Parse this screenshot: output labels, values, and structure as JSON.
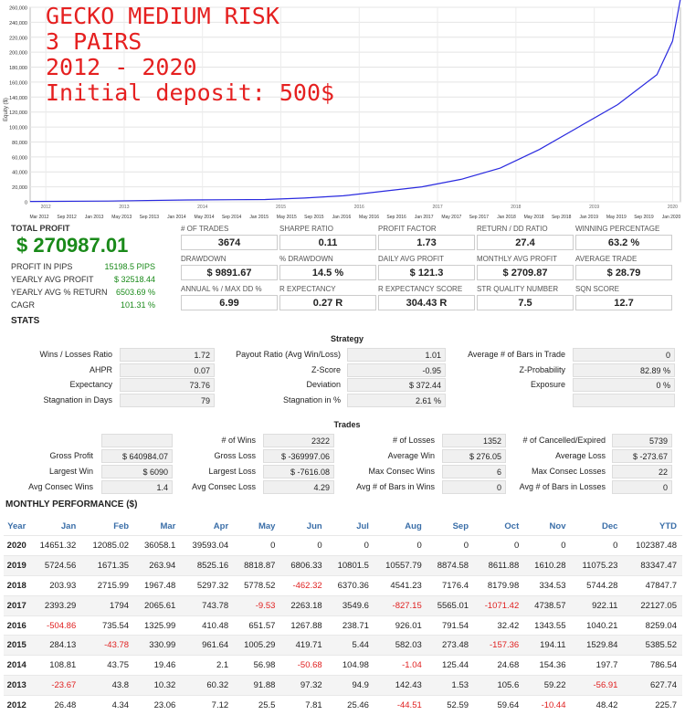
{
  "overlay": {
    "line1": "GECKO MEDIUM RISK",
    "line2": "3 PAIRS",
    "line3": "2012 - 2020",
    "line4": "Initial deposit: 500$"
  },
  "chart_data": {
    "type": "line",
    "ylabel": "Equity ($)",
    "y_ticks": [
      "0",
      "20,000",
      "40,000",
      "60,000",
      "80,000",
      "100,000",
      "120,000",
      "140,000",
      "160,000",
      "180,000",
      "200,000",
      "220,000",
      "240,000",
      "260,000"
    ],
    "ylim": [
      0,
      260000
    ],
    "x_ticks": [
      "Mar 2012",
      "Sep 2012",
      "Jan 2013",
      "May 2013",
      "Sep 2013",
      "Jan 2014",
      "May 2014",
      "Sep 2014",
      "Jan 2015",
      "May 2015",
      "Sep 2015",
      "Jan 2016",
      "May 2016",
      "Sep 2016",
      "Jan 2017",
      "May 2017",
      "Sep 2017",
      "Jan 2018",
      "May 2018",
      "Sep 2018",
      "Jan 2019",
      "May 2019",
      "Sep 2019",
      "Jan 2020"
    ],
    "x_year_ticks": [
      "2012",
      "2013",
      "2014",
      "2015",
      "2016",
      "2017",
      "2018",
      "2019",
      "2020"
    ],
    "series": [
      {
        "color": "#2a2adf",
        "x": [
          2012.0,
          2013.0,
          2014.0,
          2015.0,
          2015.5,
          2016.0,
          2016.5,
          2017.0,
          2017.5,
          2018.0,
          2018.5,
          2019.0,
          2019.5,
          2020.0,
          2020.2,
          2020.3
        ],
        "y": [
          500,
          1000,
          2500,
          3000,
          5000,
          8000,
          14000,
          20000,
          30000,
          45000,
          70000,
          100000,
          130000,
          170000,
          215000,
          270987
        ]
      }
    ],
    "grid": true
  },
  "summary": {
    "total_profit_label": "TOTAL PROFIT",
    "total_profit_value": "$ 270987.01",
    "rows": [
      {
        "label": "PROFIT IN PIPS",
        "value": "15198.5 PIPS"
      },
      {
        "label": "YEARLY AVG PROFIT",
        "value": "$ 32518.44"
      },
      {
        "label": "YEARLY AVG % RETURN",
        "value": "6503.69 %"
      },
      {
        "label": "CAGR",
        "value": "101.31 %"
      }
    ]
  },
  "metrics": [
    {
      "label": "# OF TRADES",
      "value": "3674"
    },
    {
      "label": "SHARPE RATIO",
      "value": "0.11"
    },
    {
      "label": "PROFIT FACTOR",
      "value": "1.73"
    },
    {
      "label": "RETURN / DD RATIO",
      "value": "27.4"
    },
    {
      "label": "WINNING PERCENTAGE",
      "value": "63.2 %"
    },
    {
      "label": "DRAWDOWN",
      "value": "$ 9891.67"
    },
    {
      "label": "% DRAWDOWN",
      "value": "14.5 %"
    },
    {
      "label": "DAILY AVG PROFIT",
      "value": "$ 121.3"
    },
    {
      "label": "MONTHLY AVG PROFIT",
      "value": "$ 2709.87"
    },
    {
      "label": "AVERAGE TRADE",
      "value": "$ 28.79"
    },
    {
      "label": "ANNUAL % / MAX DD %",
      "value": "6.99"
    },
    {
      "label": "R EXPECTANCY",
      "value": "0.27 R"
    },
    {
      "label": "R EXPECTANCY SCORE",
      "value": "304.43 R"
    },
    {
      "label": "STR QUALITY NUMBER",
      "value": "7.5"
    },
    {
      "label": "SQN SCORE",
      "value": "12.7"
    }
  ],
  "stats_heading": "STATS",
  "strategy": {
    "heading": "Strategy",
    "rows": [
      [
        {
          "label": "Wins / Losses Ratio",
          "value": "1.72"
        },
        {
          "label": "Payout Ratio (Avg Win/Loss)",
          "value": "1.01"
        },
        {
          "label": "Average # of Bars in Trade",
          "value": "0"
        }
      ],
      [
        {
          "label": "AHPR",
          "value": "0.07"
        },
        {
          "label": "Z-Score",
          "value": "-0.95"
        },
        {
          "label": "Z-Probability",
          "value": "82.89 %"
        }
      ],
      [
        {
          "label": "Expectancy",
          "value": "73.76"
        },
        {
          "label": "Deviation",
          "value": "$ 372.44"
        },
        {
          "label": "Exposure",
          "value": "0 %"
        }
      ],
      [
        {
          "label": "Stagnation in Days",
          "value": "79"
        },
        {
          "label": "Stagnation in %",
          "value": "2.61 %"
        },
        {
          "label": "",
          "value": ""
        }
      ]
    ]
  },
  "trades": {
    "heading": "Trades",
    "rows": [
      [
        {
          "label": "",
          "value": ""
        },
        {
          "label": "# of Wins",
          "value": "2322"
        },
        {
          "label": "# of Losses",
          "value": "1352"
        },
        {
          "label": "# of Cancelled/Expired",
          "value": "5739"
        }
      ],
      [
        {
          "label": "Gross Profit",
          "value": "$ 640984.07"
        },
        {
          "label": "Gross Loss",
          "value": "$ -369997.06"
        },
        {
          "label": "Average Win",
          "value": "$ 276.05"
        },
        {
          "label": "Average Loss",
          "value": "$ -273.67"
        }
      ],
      [
        {
          "label": "Largest Win",
          "value": "$ 6090"
        },
        {
          "label": "Largest Loss",
          "value": "$ -7616.08"
        },
        {
          "label": "Max Consec Wins",
          "value": "6"
        },
        {
          "label": "Max Consec Losses",
          "value": "22"
        }
      ],
      [
        {
          "label": "Avg Consec Wins",
          "value": "1.4"
        },
        {
          "label": "Avg Consec Loss",
          "value": "4.29"
        },
        {
          "label": "Avg # of Bars in Wins",
          "value": "0"
        },
        {
          "label": "Avg # of Bars in Losses",
          "value": "0"
        }
      ]
    ]
  },
  "monthly": {
    "heading": "MONTHLY PERFORMANCE ($)",
    "columns": [
      "Year",
      "Jan",
      "Feb",
      "Mar",
      "Apr",
      "May",
      "Jun",
      "Jul",
      "Aug",
      "Sep",
      "Oct",
      "Nov",
      "Dec",
      "YTD"
    ],
    "rows": [
      [
        "2020",
        "14651.32",
        "12085.02",
        "36058.1",
        "39593.04",
        "0",
        "0",
        "0",
        "0",
        "0",
        "0",
        "0",
        "0",
        "102387.48"
      ],
      [
        "2019",
        "5724.56",
        "1671.35",
        "263.94",
        "8525.16",
        "8818.87",
        "6806.33",
        "10801.5",
        "10557.79",
        "8874.58",
        "8611.88",
        "1610.28",
        "11075.23",
        "83347.47"
      ],
      [
        "2018",
        "203.93",
        "2715.99",
        "1967.48",
        "5297.32",
        "5778.52",
        "-462.32",
        "6370.36",
        "4541.23",
        "7176.4",
        "8179.98",
        "334.53",
        "5744.28",
        "47847.7"
      ],
      [
        "2017",
        "2393.29",
        "1794",
        "2065.61",
        "743.78",
        "-9.53",
        "2263.18",
        "3549.6",
        "-827.15",
        "5565.01",
        "-1071.42",
        "4738.57",
        "922.11",
        "22127.05"
      ],
      [
        "2016",
        "-504.86",
        "735.54",
        "1325.99",
        "410.48",
        "651.57",
        "1267.88",
        "238.71",
        "926.01",
        "791.54",
        "32.42",
        "1343.55",
        "1040.21",
        "8259.04"
      ],
      [
        "2015",
        "284.13",
        "-43.78",
        "330.99",
        "961.64",
        "1005.29",
        "419.71",
        "5.44",
        "582.03",
        "273.48",
        "-157.36",
        "194.11",
        "1529.84",
        "5385.52"
      ],
      [
        "2014",
        "108.81",
        "43.75",
        "19.46",
        "2.1",
        "56.98",
        "-50.68",
        "104.98",
        "-1.04",
        "125.44",
        "24.68",
        "154.36",
        "197.7",
        "786.54"
      ],
      [
        "2013",
        "-23.67",
        "43.8",
        "10.32",
        "60.32",
        "91.88",
        "97.32",
        "94.9",
        "142.43",
        "1.53",
        "105.6",
        "59.22",
        "-56.91",
        "627.74"
      ],
      [
        "2012",
        "26.48",
        "4.34",
        "23.06",
        "7.12",
        "25.5",
        "7.81",
        "25.46",
        "-44.51",
        "52.59",
        "59.64",
        "-10.44",
        "48.42",
        "225.7"
      ]
    ]
  }
}
